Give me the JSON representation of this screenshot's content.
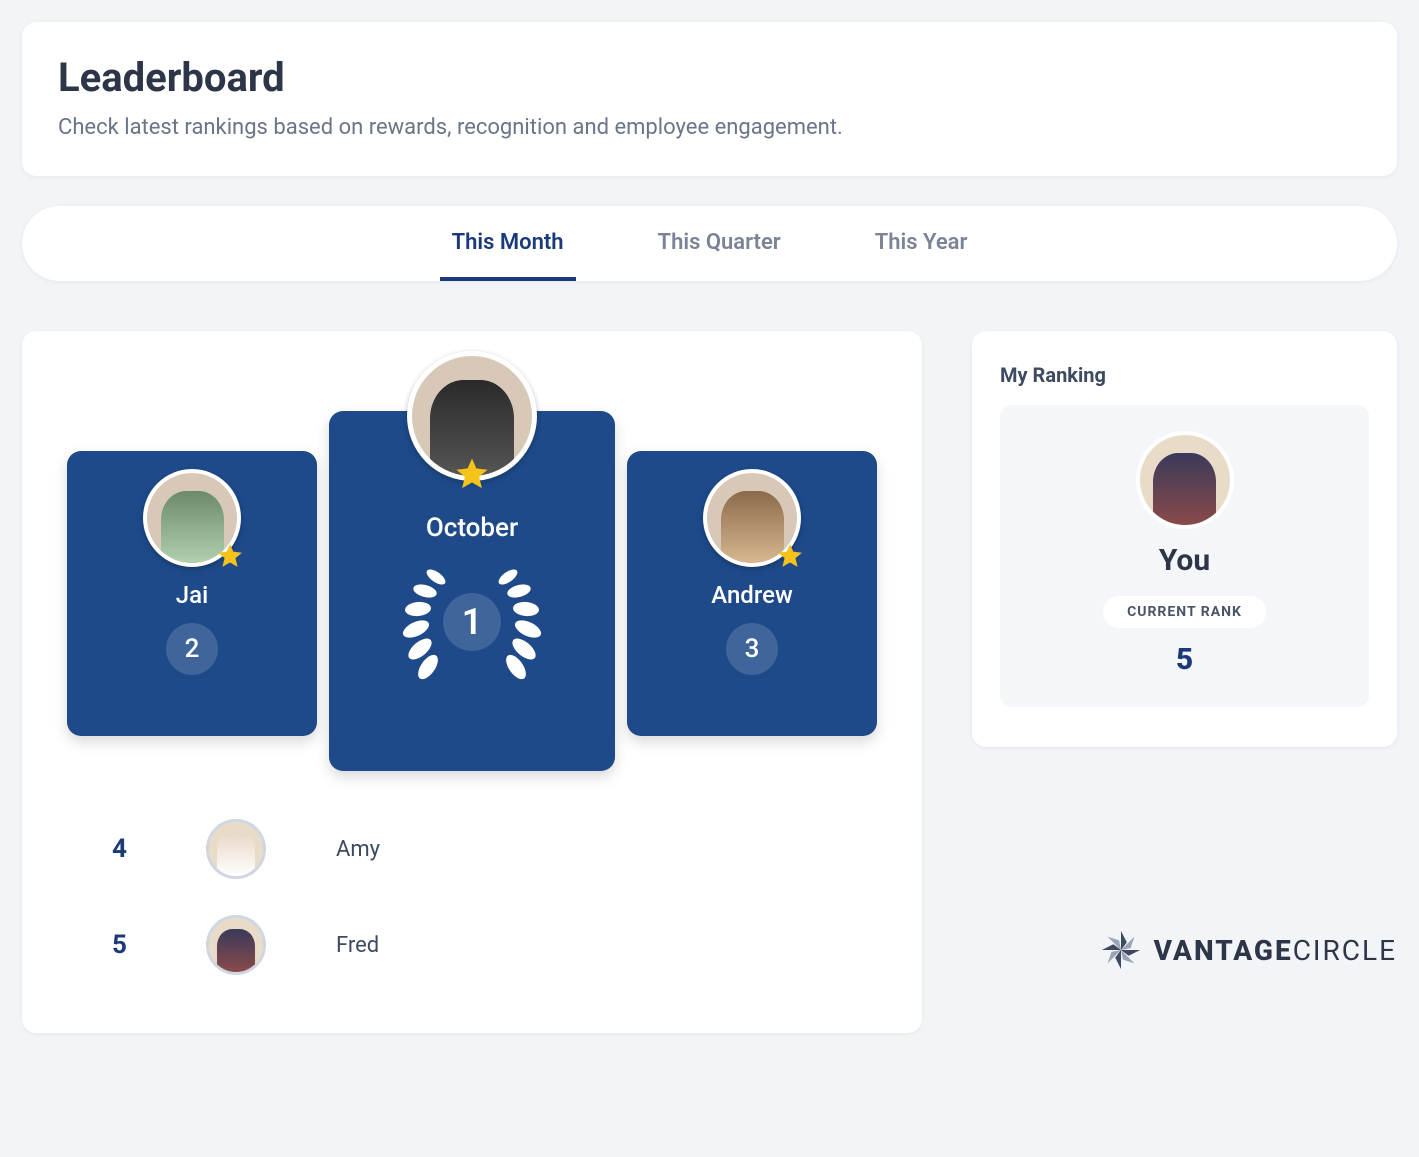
{
  "header": {
    "title": "Leaderboard",
    "subtitle": "Check latest rankings based on rewards, recognition and employee engagement."
  },
  "tabs": [
    {
      "label": "This Month",
      "active": true
    },
    {
      "label": "This Quarter",
      "active": false
    },
    {
      "label": "This Year",
      "active": false
    }
  ],
  "podium": {
    "period_label": "October",
    "first": {
      "name": "",
      "rank": 1
    },
    "second": {
      "name": "Jai",
      "rank": 2
    },
    "third": {
      "name": "Andrew",
      "rank": 3
    }
  },
  "rank_list": [
    {
      "rank": 4,
      "name": "Amy"
    },
    {
      "rank": 5,
      "name": "Fred"
    }
  ],
  "my_ranking": {
    "section_title": "My Ranking",
    "you_label": "You",
    "pill_label": "CURRENT RANK",
    "rank": 5
  },
  "brand": {
    "bold": "VANTAGE",
    "light": "CIRCLE"
  },
  "colors": {
    "accent": "#1b3a7a",
    "podium": "#1e4a8a",
    "star": "#f6c21c"
  }
}
